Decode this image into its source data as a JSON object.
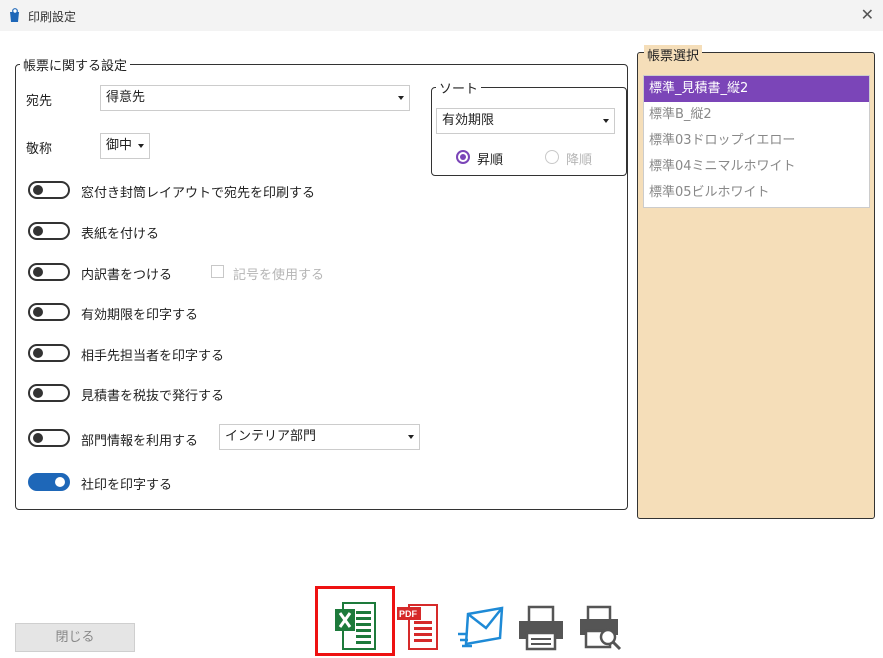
{
  "window": {
    "title": "印刷設定",
    "close_glyph": "✕"
  },
  "settings": {
    "legend": "帳票に関する設定",
    "recipient_label": "宛先",
    "recipient_value": "得意先",
    "honorific_label": "敬称",
    "honorific_value": "御中",
    "toggles": [
      {
        "label": "窓付き封筒レイアウトで宛先を印刷する",
        "on": false
      },
      {
        "label": "表紙を付ける",
        "on": false
      },
      {
        "label": "内訳書をつける",
        "on": false
      },
      {
        "label": "有効期限を印字する",
        "on": false
      },
      {
        "label": "相手先担当者を印字する",
        "on": false
      },
      {
        "label": "見積書を税抜で発行する",
        "on": false
      },
      {
        "label": "部門情報を利用する",
        "on": false
      },
      {
        "label": "社印を印字する",
        "on": true
      }
    ],
    "symbol_checkbox_label": "記号を使用する",
    "department_value": "インテリア部門"
  },
  "sort": {
    "legend": "ソート",
    "field_value": "有効期限",
    "ascending_label": "昇順",
    "descending_label": "降順",
    "selected": "ascending"
  },
  "forms": {
    "legend": "帳票選択",
    "items": [
      "標準_見積書_縦2",
      "標準B_縦2",
      "標準03ドロップイエロー",
      "標準04ミニマルホワイト",
      "標準05ビルホワイト"
    ],
    "selected_index": 0
  },
  "footer": {
    "close_label": "閉じる",
    "icons": [
      "excel-icon",
      "pdf-icon",
      "mail-icon",
      "printer-icon",
      "print-preview-icon"
    ],
    "pdf_badge": "PDF"
  },
  "colors": {
    "accent": "#7b45b8",
    "toggle_on": "#1e67b8",
    "panel_bg": "#f5deb9",
    "highlight": "#e11111"
  }
}
